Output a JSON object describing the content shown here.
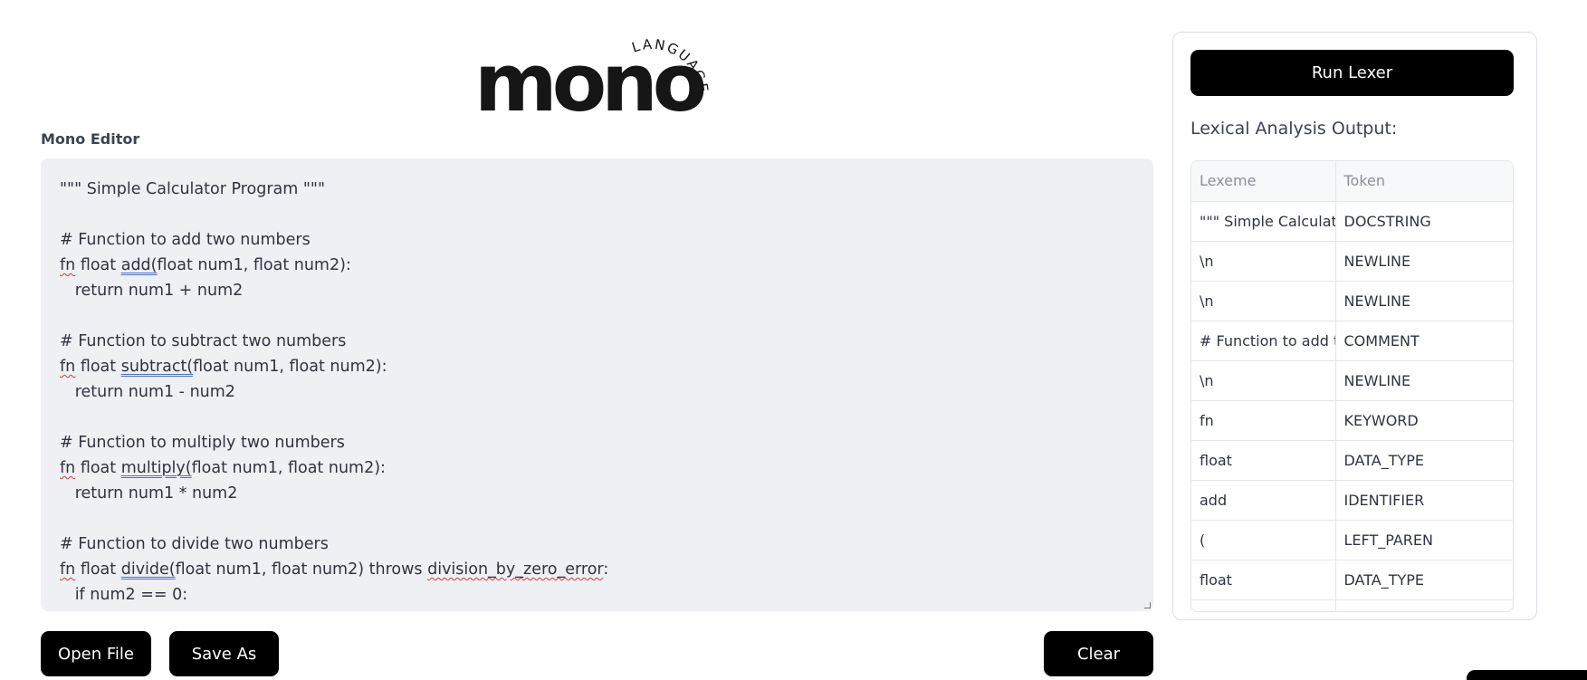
{
  "logo": {
    "word": "mono",
    "arc_text": "LANGUAGE"
  },
  "editor": {
    "label": "Mono Editor",
    "lines": [
      [
        {
          "t": "\"\"\" Simple Calculator Program \"\"\""
        }
      ],
      [
        {
          "t": ""
        }
      ],
      [
        {
          "t": "# Function to add two numbers"
        }
      ],
      [
        {
          "t": "fn",
          "s": "wavy"
        },
        {
          "t": " float "
        },
        {
          "t": "add(",
          "s": "dbl"
        },
        {
          "t": "float num1, float num2):"
        }
      ],
      [
        {
          "t": "   return num1 + num2"
        }
      ],
      [
        {
          "t": ""
        }
      ],
      [
        {
          "t": "# Function to subtract two numbers"
        }
      ],
      [
        {
          "t": "fn",
          "s": "wavy"
        },
        {
          "t": " float "
        },
        {
          "t": "subtract(",
          "s": "dbl"
        },
        {
          "t": "float num1, float num2):"
        }
      ],
      [
        {
          "t": "   return num1 - num2"
        }
      ],
      [
        {
          "t": ""
        }
      ],
      [
        {
          "t": "# Function to multiply two numbers"
        }
      ],
      [
        {
          "t": "fn",
          "s": "wavy"
        },
        {
          "t": " float "
        },
        {
          "t": "multiply(",
          "s": "dbl"
        },
        {
          "t": "float num1, float num2):"
        }
      ],
      [
        {
          "t": "   return num1 * num2"
        }
      ],
      [
        {
          "t": ""
        }
      ],
      [
        {
          "t": "# Function to divide two numbers"
        }
      ],
      [
        {
          "t": "fn",
          "s": "wavy"
        },
        {
          "t": " float "
        },
        {
          "t": "divide(",
          "s": "dbl"
        },
        {
          "t": "float num1, float num2) throws "
        },
        {
          "t": "division_by_zero_error",
          "s": "wavy"
        },
        {
          "t": ":"
        }
      ],
      [
        {
          "t": "   if num2 == 0:"
        }
      ]
    ]
  },
  "buttons": {
    "open_file": "Open File",
    "save_as": "Save As",
    "clear": "Clear",
    "run_lexer": "Run Lexer"
  },
  "output": {
    "label": "Lexical Analysis Output:",
    "columns": [
      "Lexeme",
      "Token"
    ],
    "rows": [
      [
        "\"\"\" Simple Calculator Program \"\"\"",
        "DOCSTRING"
      ],
      [
        "\\n",
        "NEWLINE"
      ],
      [
        "\\n",
        "NEWLINE"
      ],
      [
        "# Function to add two numbers",
        "COMMENT"
      ],
      [
        "\\n",
        "NEWLINE"
      ],
      [
        "fn",
        "KEYWORD"
      ],
      [
        "float",
        "DATA_TYPE"
      ],
      [
        "add",
        "IDENTIFIER"
      ],
      [
        "(",
        "LEFT_PAREN"
      ],
      [
        "float",
        "DATA_TYPE"
      ],
      [
        "",
        ""
      ]
    ]
  }
}
